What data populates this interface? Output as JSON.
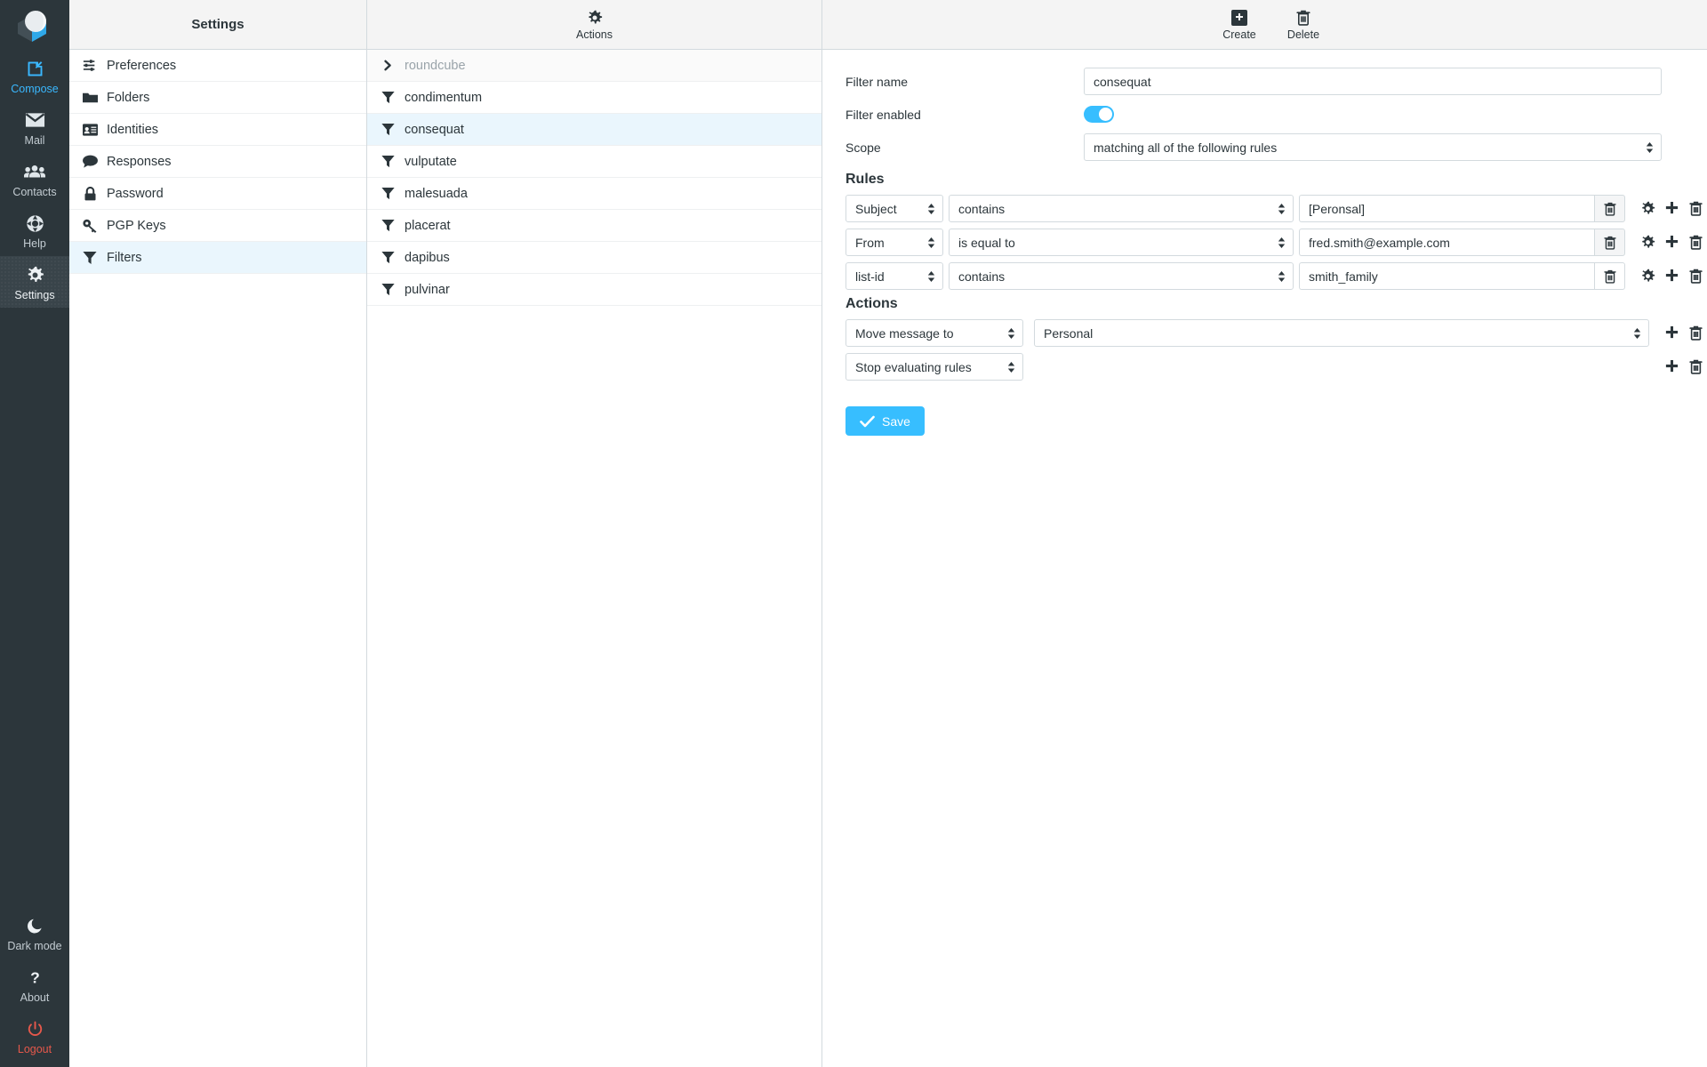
{
  "rail": {
    "logo_name": "roundcube-logo",
    "items": [
      {
        "label": "Compose",
        "icon": "compose-icon",
        "state": "compose"
      },
      {
        "label": "Mail",
        "icon": "mail-icon",
        "state": "normal"
      },
      {
        "label": "Contacts",
        "icon": "contacts-icon",
        "state": "normal"
      },
      {
        "label": "Help",
        "icon": "help-icon",
        "state": "normal"
      },
      {
        "label": "Settings",
        "icon": "gear-icon",
        "state": "active"
      }
    ],
    "bottom_items": [
      {
        "label": "Dark mode",
        "icon": "moon-icon"
      },
      {
        "label": "About",
        "icon": "question-icon"
      },
      {
        "label": "Logout",
        "icon": "power-icon"
      }
    ]
  },
  "settings_panel": {
    "title": "Settings",
    "items": [
      {
        "label": "Preferences",
        "icon": "sliders-icon",
        "selected": false
      },
      {
        "label": "Folders",
        "icon": "folder-icon",
        "selected": false
      },
      {
        "label": "Identities",
        "icon": "id-card-icon",
        "selected": false
      },
      {
        "label": "Responses",
        "icon": "comment-icon",
        "selected": false
      },
      {
        "label": "Password",
        "icon": "lock-icon",
        "selected": false
      },
      {
        "label": "PGP Keys",
        "icon": "key-icon",
        "selected": false
      },
      {
        "label": "Filters",
        "icon": "filter-icon",
        "selected": true
      }
    ]
  },
  "filters_panel": {
    "actions_label": "Actions",
    "actions_icon": "gear-icon",
    "filter_set": {
      "label": "roundcube",
      "icon": "chevron-right-icon"
    },
    "items": [
      {
        "label": "condimentum",
        "icon": "filter-icon",
        "selected": false
      },
      {
        "label": "consequat",
        "icon": "filter-icon",
        "selected": true
      },
      {
        "label": "vulputate",
        "icon": "filter-icon",
        "selected": false
      },
      {
        "label": "malesuada",
        "icon": "filter-icon",
        "selected": false
      },
      {
        "label": "placerat",
        "icon": "filter-icon",
        "selected": false
      },
      {
        "label": "dapibus",
        "icon": "filter-icon",
        "selected": false
      },
      {
        "label": "pulvinar",
        "icon": "filter-icon",
        "selected": false
      }
    ]
  },
  "content_toolbar": {
    "create_label": "Create",
    "create_icon": "plus-square-icon",
    "delete_label": "Delete",
    "delete_icon": "trash-icon"
  },
  "form": {
    "filter_name_label": "Filter name",
    "filter_name_value": "consequat",
    "filter_enabled_label": "Filter enabled",
    "filter_enabled": true,
    "scope_label": "Scope",
    "scope_value": "matching all of the following rules",
    "rules_title": "Rules",
    "rules": [
      {
        "header": "Subject",
        "operator": "contains",
        "value": "[Peronsal]"
      },
      {
        "header": "From",
        "operator": "is equal to",
        "value": "fred.smith@example.com"
      },
      {
        "header": "list-id",
        "operator": "contains",
        "value": "smith_family"
      }
    ],
    "actions_title": "Actions",
    "actions": [
      {
        "type": "Move message to",
        "target": "Personal",
        "has_target": true
      },
      {
        "type": "Stop evaluating rules",
        "target": "",
        "has_target": false
      }
    ],
    "save_label": "Save",
    "save_icon": "check-icon"
  },
  "colors": {
    "accent": "#37beff",
    "rail_bg": "#2c363b",
    "selected_row": "#eaf6fd",
    "logout": "#e6584b",
    "header_bg": "#f4f4f4"
  }
}
